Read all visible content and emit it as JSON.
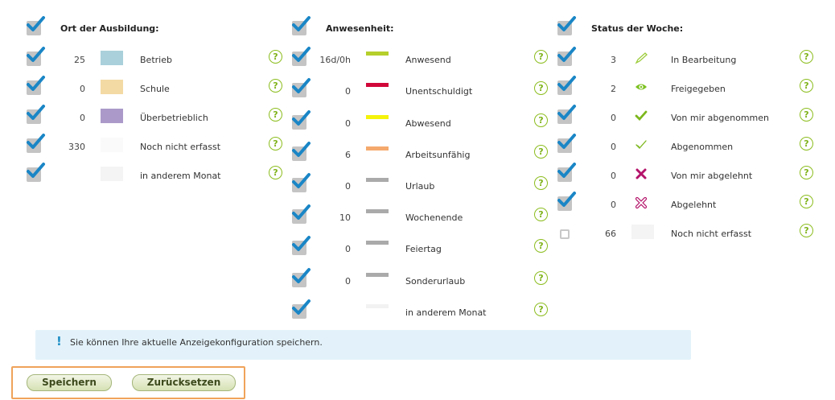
{
  "columns": [
    {
      "title": "Ort der Ausbildung:",
      "rows": [
        {
          "count": "25",
          "label": "Betrieb",
          "kind": "swatch",
          "color": "#a9d0db",
          "checked": true
        },
        {
          "count": "0",
          "label": "Schule",
          "kind": "swatch",
          "color": "#f3d9a4",
          "checked": true
        },
        {
          "count": "0",
          "label": "Überbetrieblich",
          "kind": "swatch",
          "color": "#ab9ac9",
          "checked": true
        },
        {
          "count": "330",
          "label": "Noch nicht erfasst",
          "kind": "swatch",
          "color": "#fafafa",
          "checked": true
        },
        {
          "count": "",
          "label": "in anderem Monat",
          "kind": "swatch",
          "color": "#f4f4f4",
          "checked": true
        }
      ]
    },
    {
      "title": "Anwesenheit:",
      "rows": [
        {
          "count": "16d/0h",
          "label": "Anwesend",
          "kind": "line",
          "color": "#b5cf2b",
          "checked": true
        },
        {
          "count": "0",
          "label": "Unentschuldigt",
          "kind": "line",
          "color": "#d1073a",
          "checked": true
        },
        {
          "count": "0",
          "label": "Abwesend",
          "kind": "line",
          "color": "#f5f30a",
          "checked": true
        },
        {
          "count": "6",
          "label": "Arbeitsunfähig",
          "kind": "line",
          "color": "#f5a96c",
          "checked": true
        },
        {
          "count": "0",
          "label": "Urlaub",
          "kind": "line",
          "color": "#aaaaaa",
          "checked": true
        },
        {
          "count": "10",
          "label": "Wochenende",
          "kind": "line",
          "color": "#aaaaaa",
          "checked": true
        },
        {
          "count": "0",
          "label": "Feiertag",
          "kind": "line",
          "color": "#aaaaaa",
          "checked": true
        },
        {
          "count": "0",
          "label": "Sonderurlaub",
          "kind": "line",
          "color": "#aaaaaa",
          "checked": true
        },
        {
          "count": "",
          "label": "in anderem Monat",
          "kind": "line",
          "color": "#f2f2f2",
          "checked": true
        }
      ]
    },
    {
      "title": "Status der Woche:",
      "rows": [
        {
          "count": "3",
          "label": "In Bearbeitung",
          "kind": "icon",
          "icon": "pencil-icon",
          "color": "#9ccc3a",
          "checked": true
        },
        {
          "count": "2",
          "label": "Freigegeben",
          "kind": "icon",
          "icon": "eye-icon",
          "color": "#7cc11f",
          "checked": true
        },
        {
          "count": "0",
          "label": "Von mir abgenommen",
          "kind": "icon",
          "icon": "check-bold-icon",
          "color": "#7cb71c",
          "checked": true
        },
        {
          "count": "0",
          "label": "Abgenommen",
          "kind": "icon",
          "icon": "check-outline-icon",
          "color": "#7cb71c",
          "checked": true
        },
        {
          "count": "0",
          "label": "Von mir abgelehnt",
          "kind": "icon",
          "icon": "cross-bold-icon",
          "color": "#b4136a",
          "checked": true
        },
        {
          "count": "0",
          "label": "Abgelehnt",
          "kind": "icon",
          "icon": "cross-outline-icon",
          "color": "#b4136a",
          "checked": true
        },
        {
          "count": "66",
          "label": "Noch nicht erfasst",
          "kind": "swatch",
          "color": "#f4f4f4",
          "checked": false
        }
      ]
    }
  ],
  "help_symbol": "?",
  "info": {
    "symbol": "!",
    "message": "Sie können Ihre aktuelle Anzeigekonfiguration speichern."
  },
  "buttons": {
    "save": "Speichern",
    "reset": "Zurücksetzen"
  },
  "colors": {
    "checkbox_tick": "#1a86c6",
    "checkbox_box": "#c4c4c4",
    "help_green": "#8cbd1e",
    "info_bg": "#e3f2fa",
    "button_group_border": "#f0a35a"
  }
}
